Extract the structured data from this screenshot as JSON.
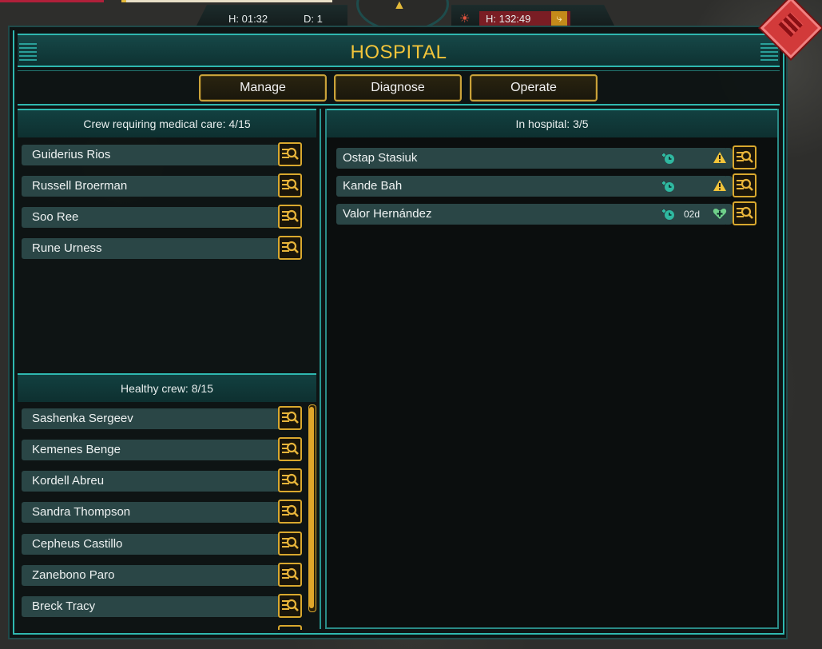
{
  "hud": {
    "time_left": "H: 01:32",
    "day": "D: 1",
    "time_right": "H: 132:49"
  },
  "window": {
    "title": "HOSPITAL"
  },
  "tabs": [
    {
      "label": "Manage"
    },
    {
      "label": "Diagnose"
    },
    {
      "label": "Operate"
    }
  ],
  "medical_care": {
    "header": "Crew requiring medical care: 4/15",
    "crew": [
      {
        "name": "Guiderius Rios"
      },
      {
        "name": "Russell Broerman"
      },
      {
        "name": "Soo Ree"
      },
      {
        "name": "Rune Urness"
      }
    ]
  },
  "healthy": {
    "header": "Healthy crew: 8/15",
    "crew": [
      {
        "name": "Sashenka Sergeev"
      },
      {
        "name": "Kemenes Benge"
      },
      {
        "name": "Kordell Abreu"
      },
      {
        "name": "Sandra Thompson"
      },
      {
        "name": "Cepheus Castillo"
      },
      {
        "name": "Zanebono Paro"
      },
      {
        "name": "Breck Tracy"
      }
    ]
  },
  "hospital": {
    "header": "In hospital: 3/5",
    "patients": [
      {
        "name": "Ostap Stasiuk",
        "status_icon": "warning-icon",
        "days": ""
      },
      {
        "name": "Kande Bah",
        "status_icon": "warning-icon",
        "days": ""
      },
      {
        "name": "Valor Hernández",
        "status_icon": "heart-plus-icon",
        "days": "02d"
      }
    ]
  },
  "colors": {
    "accent": "#2fb8b0",
    "title": "#f2c43a",
    "button_border": "#c9a23a",
    "row": "#2a4646",
    "warning": "#f2c43a",
    "heal": "#6fd08a"
  }
}
